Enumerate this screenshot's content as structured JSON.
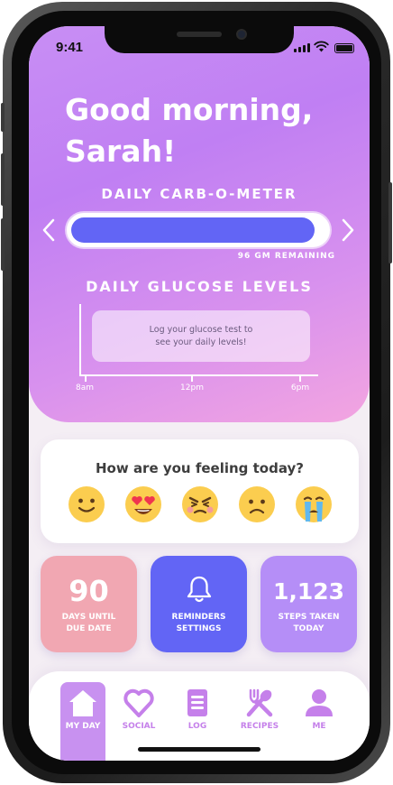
{
  "status_bar": {
    "time": "9:41"
  },
  "header": {
    "greeting": "Good morning,\nSarah!",
    "meter_title": "DAILY CARB-O-METER",
    "meter_fill_fraction": 0.95,
    "remaining": "96 GM REMAINING",
    "glucose_title": "DAILY GLUCOSE LEVELS",
    "glucose_prompt": "Log your glucose test to\nsee your daily levels!",
    "x_ticks": [
      "8am",
      "12pm",
      "6pm"
    ]
  },
  "feeling": {
    "question": "How are you feeling today?",
    "emojis": [
      "smiling-face-icon",
      "heart-eyes-face-icon",
      "angry-face-icon",
      "frowning-face-icon",
      "crying-face-icon"
    ]
  },
  "tiles": [
    {
      "value": "90",
      "label": "DAYS UNTIL\nDUE DATE",
      "color": "#f1a7b2"
    },
    {
      "icon": "bell-icon",
      "label": "REMINDERS\nSETTINGS",
      "color": "#6265f5"
    },
    {
      "value": "1,123",
      "label": "STEPS TAKEN\nTODAY",
      "color": "#b58ef7"
    }
  ],
  "nav": {
    "items": [
      {
        "label": "MY DAY",
        "icon": "home-icon",
        "active": true
      },
      {
        "label": "SOCIAL",
        "icon": "heart-icon"
      },
      {
        "label": "LOG",
        "icon": "notepad-icon"
      },
      {
        "label": "RECIPES",
        "icon": "utensils-icon"
      },
      {
        "label": "ME",
        "icon": "person-icon"
      }
    ]
  },
  "colors": {
    "accent": "#6265f5",
    "brand_purple": "#c07ff3",
    "brand_pink": "#f3a5e0",
    "nav_label": "#c580ea"
  }
}
